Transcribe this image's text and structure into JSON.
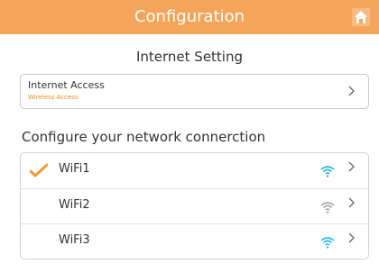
{
  "header": {
    "title": "Configuration",
    "background_color": "#f5a55a",
    "home_icon": "home-icon"
  },
  "internet_setting": {
    "section_title": "Internet  Setting",
    "access": {
      "label": "Internet Access",
      "value": "Wireless Access",
      "value_color": "#f08a18"
    }
  },
  "network": {
    "heading": "Configure your network connerction",
    "items": [
      {
        "label": "WiFi1",
        "selected": true,
        "signal_color": "#2bb3d9",
        "signal_icon": "wifi-signal-icon"
      },
      {
        "label": "WiFi2",
        "selected": false,
        "signal_color": "#a8a8a8",
        "signal_icon": "wifi-signal-icon"
      },
      {
        "label": "WiFi3",
        "selected": false,
        "signal_color": "#2bb8ec",
        "signal_icon": "wifi-signal-icon"
      }
    ]
  },
  "icons": {
    "chevron": "chevron-right-icon",
    "check": "checkmark-icon"
  }
}
